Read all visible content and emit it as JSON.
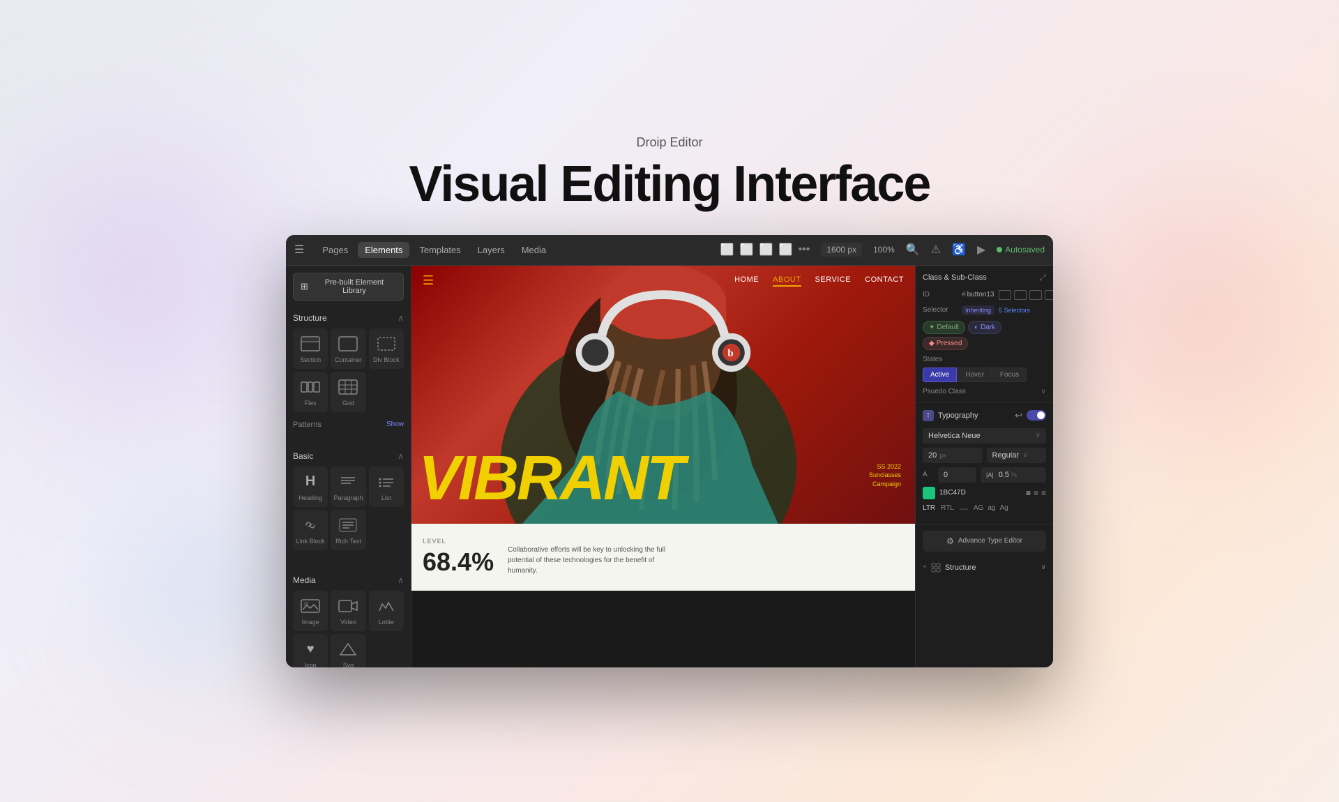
{
  "app": {
    "subtitle": "Droip Editor",
    "title": "Visual Editing Interface"
  },
  "toolbar": {
    "nav_items": [
      "Pages",
      "Elements",
      "Templates",
      "Layers",
      "Media"
    ],
    "active_nav": "Elements",
    "width": "1600 px",
    "zoom": "100%",
    "autosave": "Autosaved"
  },
  "left_sidebar": {
    "library_btn": "Pre-built Element Library",
    "sections": [
      {
        "title": "Structure",
        "items": [
          {
            "label": "Section",
            "icon": "⊞"
          },
          {
            "label": "Container",
            "icon": "□"
          },
          {
            "label": "Div Block",
            "icon": "⬚"
          },
          {
            "label": "Flex",
            "icon": "≡"
          },
          {
            "label": "Grid",
            "icon": "⊞"
          }
        ],
        "patterns": "Patterns",
        "show": "Show"
      },
      {
        "title": "Basic",
        "items": [
          {
            "label": "Heading",
            "icon": "H"
          },
          {
            "label": "Paragraph",
            "icon": "¶"
          },
          {
            "label": "List",
            "icon": "≡"
          },
          {
            "label": "Link Block",
            "icon": "⌘"
          },
          {
            "label": "Rich Text",
            "icon": "▤"
          }
        ]
      },
      {
        "title": "Media",
        "items": [
          {
            "label": "Image",
            "icon": "🖼"
          },
          {
            "label": "Video",
            "icon": "▶"
          },
          {
            "label": "Lottie",
            "icon": "📈"
          },
          {
            "label": "Icon",
            "icon": "♥"
          },
          {
            "label": "Svg",
            "icon": "◇"
          }
        ]
      }
    ]
  },
  "canvas": {
    "navbar": {
      "links": [
        "HOME",
        "ABOUT",
        "SERVICE",
        "CONTACT"
      ],
      "active": "ABOUT"
    },
    "hero_text": "VIBRANT",
    "campaign_text": "SS 2022\nSunclasses\nCampaign",
    "bottom": {
      "level_label": "LEVEL",
      "percent": "68.4%",
      "description": "Collaborative efforts will be key to unlocking the full potential of these technologies for the benefit of humanity."
    }
  },
  "right_panel": {
    "class_section": {
      "title": "Class & Sub-Class",
      "id_label": "ID",
      "id_value": "button13",
      "selector_label": "Selector",
      "inheriting": "Inheriting",
      "selectors_count": "5 Selectors",
      "chips": [
        {
          "label": "Default",
          "type": "default"
        },
        {
          "label": "Dark",
          "type": "dark"
        },
        {
          "label": "Pressed",
          "type": "pressed"
        }
      ],
      "states_label": "States",
      "states": [
        "Active",
        "Hover",
        "Focus"
      ],
      "active_state": "Active",
      "pseudo_label": "Psuedo Class"
    },
    "typography": {
      "title": "Typography",
      "font": "Helvetica Neue",
      "size": "20",
      "size_unit": "px",
      "weight": "Regular",
      "tracking": "0",
      "line_height": "0.5",
      "line_height_unit": "%",
      "color": "1BC47D",
      "align_icons": [
        "align-left",
        "align-center",
        "align-right"
      ],
      "direction_ltr": "LTR",
      "direction_rtl": "RTL",
      "case_options": [
        "AG",
        "ag",
        "Ag"
      ],
      "advance_type_btn": "Advance Type Editor"
    },
    "structure_section": {
      "title": "Structure",
      "prefix": "+"
    }
  }
}
